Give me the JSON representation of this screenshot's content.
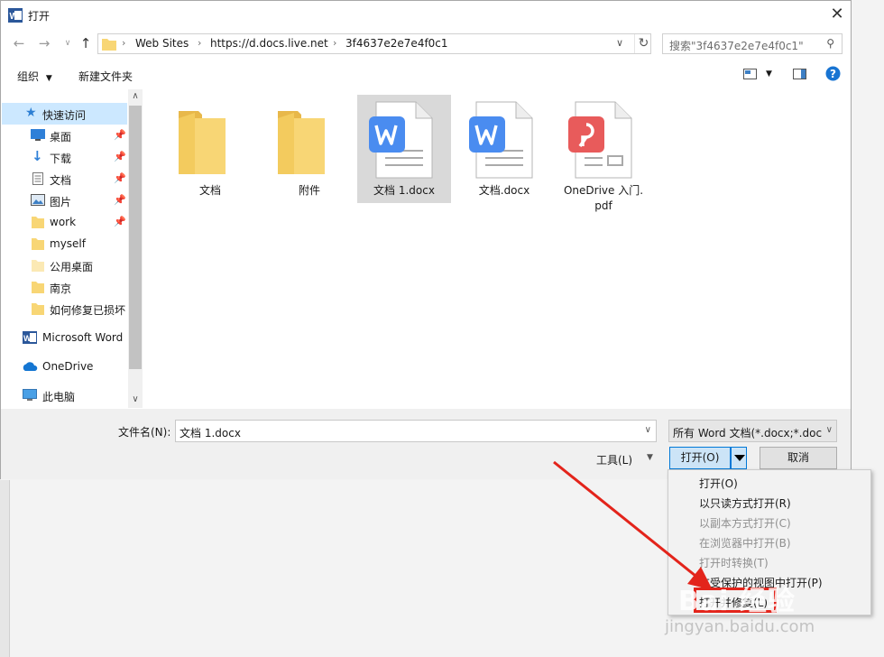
{
  "window": {
    "title": "打开",
    "close_glyph": "✕"
  },
  "address": {
    "crumbs": [
      "Web Sites",
      "https://d.docs.live.net",
      "3f4637e2e7e4f0c1"
    ]
  },
  "search": {
    "placeholder": "搜索\"3f4637e2e7e4f0c1\""
  },
  "toolbar": {
    "organize": "组织",
    "new_folder": "新建文件夹"
  },
  "sidebar": {
    "items": [
      {
        "label": "快速访问",
        "icon": "star-icon",
        "active": true
      },
      {
        "label": "桌面",
        "icon": "desktop-icon",
        "pinned": true
      },
      {
        "label": "下载",
        "icon": "download-icon",
        "pinned": true
      },
      {
        "label": "文档",
        "icon": "document-icon",
        "pinned": true
      },
      {
        "label": "图片",
        "icon": "pictures-icon",
        "pinned": true
      },
      {
        "label": "work",
        "icon": "folder-icon",
        "pinned": true
      },
      {
        "label": "myself",
        "icon": "folder-icon"
      },
      {
        "label": "公用桌面",
        "icon": "folder-icon"
      },
      {
        "label": "南京",
        "icon": "folder-icon"
      },
      {
        "label": "如何修复已损坏",
        "icon": "folder-icon"
      },
      {
        "label": "Microsoft Word",
        "icon": "word-icon"
      },
      {
        "label": "OneDrive",
        "icon": "cloud-icon"
      },
      {
        "label": "此电脑",
        "icon": "computer-icon"
      }
    ]
  },
  "files": [
    {
      "name": "文档",
      "type": "folder"
    },
    {
      "name": "附件",
      "type": "folder"
    },
    {
      "name": "文档 1.docx",
      "type": "word",
      "selected": true
    },
    {
      "name": "文档.docx",
      "type": "word"
    },
    {
      "name": "OneDrive 入门.pdf",
      "name_line1": "OneDrive 入门.",
      "name_line2": "pdf",
      "type": "pdf"
    }
  ],
  "bottom": {
    "filename_label": "文件名(N):",
    "filename_value": "文档 1.docx",
    "filter_value": "所有 Word 文档(*.docx;*.docm;*.dotx;*.dotm;*.doc)",
    "tools_label": "工具(L)",
    "open_label": "打开(O)",
    "cancel_label": "取消"
  },
  "open_menu": {
    "items": [
      {
        "label": "打开(O)",
        "enabled": true
      },
      {
        "label": "以只读方式打开(R)",
        "enabled": true
      },
      {
        "label": "以副本方式打开(C)",
        "enabled": false
      },
      {
        "label": "在浏览器中打开(B)",
        "enabled": false
      },
      {
        "label": "打开时转换(T)",
        "enabled": false
      },
      {
        "label": "在受保护的视图中打开(P)",
        "enabled": true
      },
      {
        "label": "打开并修复(L)",
        "enabled": true
      }
    ]
  },
  "watermark": {
    "text": "Bai 经验",
    "url": "jingyan.baidu.com"
  },
  "colors": {
    "accent": "#0078d7",
    "highlight": "#e3241b",
    "selected_bg": "#cce8ff",
    "word_blue": "#4a8cf0",
    "pdf_red": "#e85b5b",
    "folder": "#f8d675"
  }
}
